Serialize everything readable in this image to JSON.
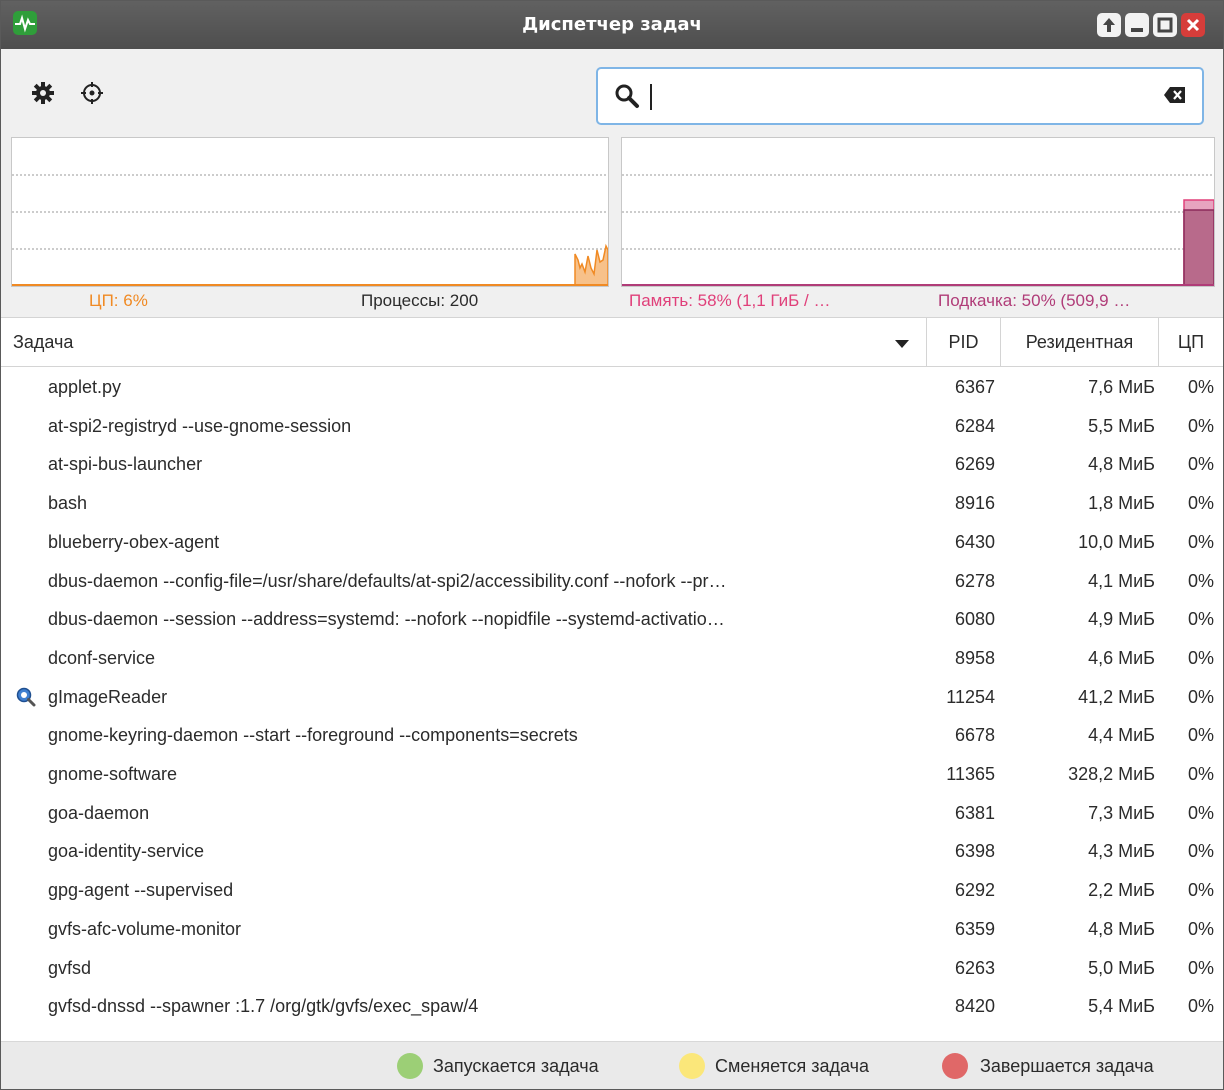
{
  "window": {
    "title": "Диспетчер задач",
    "icons": {
      "app": "system-monitor-icon",
      "up": "arrow-up-icon",
      "minimize": "minimize-icon",
      "maximize": "maximize-icon",
      "close": "close-icon"
    }
  },
  "toolbar": {
    "settings_icon": "gear-icon",
    "target_icon": "crosshair-icon",
    "search": {
      "value": "",
      "placeholder": "",
      "icon": "search-icon",
      "clear_icon": "clear-text-icon"
    }
  },
  "graphs": {
    "cpu_color": "#f08a24",
    "mem_color": "#e0407a",
    "swap_color": "#b03c78"
  },
  "status": {
    "cpu": "ЦП: 6%",
    "processes": "Процессы: 200",
    "memory": "Память: 58% (1,1 ГиБ / …",
    "swap": "Подкачка: 50% (509,9 …"
  },
  "table": {
    "columns": {
      "task": "Задача",
      "pid": "PID",
      "resident": "Резидентная",
      "cpu": "ЦП"
    },
    "sort_icon": "sort-descending-icon",
    "rows": [
      {
        "name": "applet.py",
        "pid": "6367",
        "res": "7,6 МиБ",
        "cpu": "0%"
      },
      {
        "name": "at-spi2-registryd --use-gnome-session",
        "pid": "6284",
        "res": "5,5 МиБ",
        "cpu": "0%"
      },
      {
        "name": "at-spi-bus-launcher",
        "pid": "6269",
        "res": "4,8 МиБ",
        "cpu": "0%"
      },
      {
        "name": "bash",
        "pid": "8916",
        "res": "1,8 МиБ",
        "cpu": "0%"
      },
      {
        "name": "blueberry-obex-agent",
        "pid": "6430",
        "res": "10,0 МиБ",
        "cpu": "0%"
      },
      {
        "name": "dbus-daemon --config-file=/usr/share/defaults/at-spi2/accessibility.conf --nofork --pr…",
        "pid": "6278",
        "res": "4,1 МиБ",
        "cpu": "0%"
      },
      {
        "name": "dbus-daemon --session --address=systemd: --nofork --nopidfile --systemd-activatio…",
        "pid": "6080",
        "res": "4,9 МиБ",
        "cpu": "0%"
      },
      {
        "name": "dconf-service",
        "pid": "8958",
        "res": "4,6 МиБ",
        "cpu": "0%"
      },
      {
        "name": "gImageReader",
        "pid": "11254",
        "res": "41,2 МиБ",
        "cpu": "0%",
        "icon": "gimagereader-icon"
      },
      {
        "name": "gnome-keyring-daemon --start --foreground --components=secrets",
        "pid": "6678",
        "res": "4,4 МиБ",
        "cpu": "0%"
      },
      {
        "name": "gnome-software",
        "pid": "11365",
        "res": "328,2 МиБ",
        "cpu": "0%"
      },
      {
        "name": "goa-daemon",
        "pid": "6381",
        "res": "7,3 МиБ",
        "cpu": "0%"
      },
      {
        "name": "goa-identity-service",
        "pid": "6398",
        "res": "4,3 МиБ",
        "cpu": "0%"
      },
      {
        "name": "gpg-agent --supervised",
        "pid": "6292",
        "res": "2,2 МиБ",
        "cpu": "0%"
      },
      {
        "name": "gvfs-afc-volume-monitor",
        "pid": "6359",
        "res": "4,8 МиБ",
        "cpu": "0%"
      },
      {
        "name": "gvfsd",
        "pid": "6263",
        "res": "5,0 МиБ",
        "cpu": "0%"
      },
      {
        "name": "gvfsd-dnssd --spawner :1.7 /org/gtk/gvfs/exec_spaw/4",
        "pid": "8420",
        "res": "5,4 МиБ",
        "cpu": "0%"
      }
    ]
  },
  "legend": [
    {
      "label": "Запускается задача",
      "color": "#9ccf76"
    },
    {
      "label": "Сменяется задача",
      "color": "#fbe77a"
    },
    {
      "label": "Завершается задача",
      "color": "#e06868"
    }
  ]
}
